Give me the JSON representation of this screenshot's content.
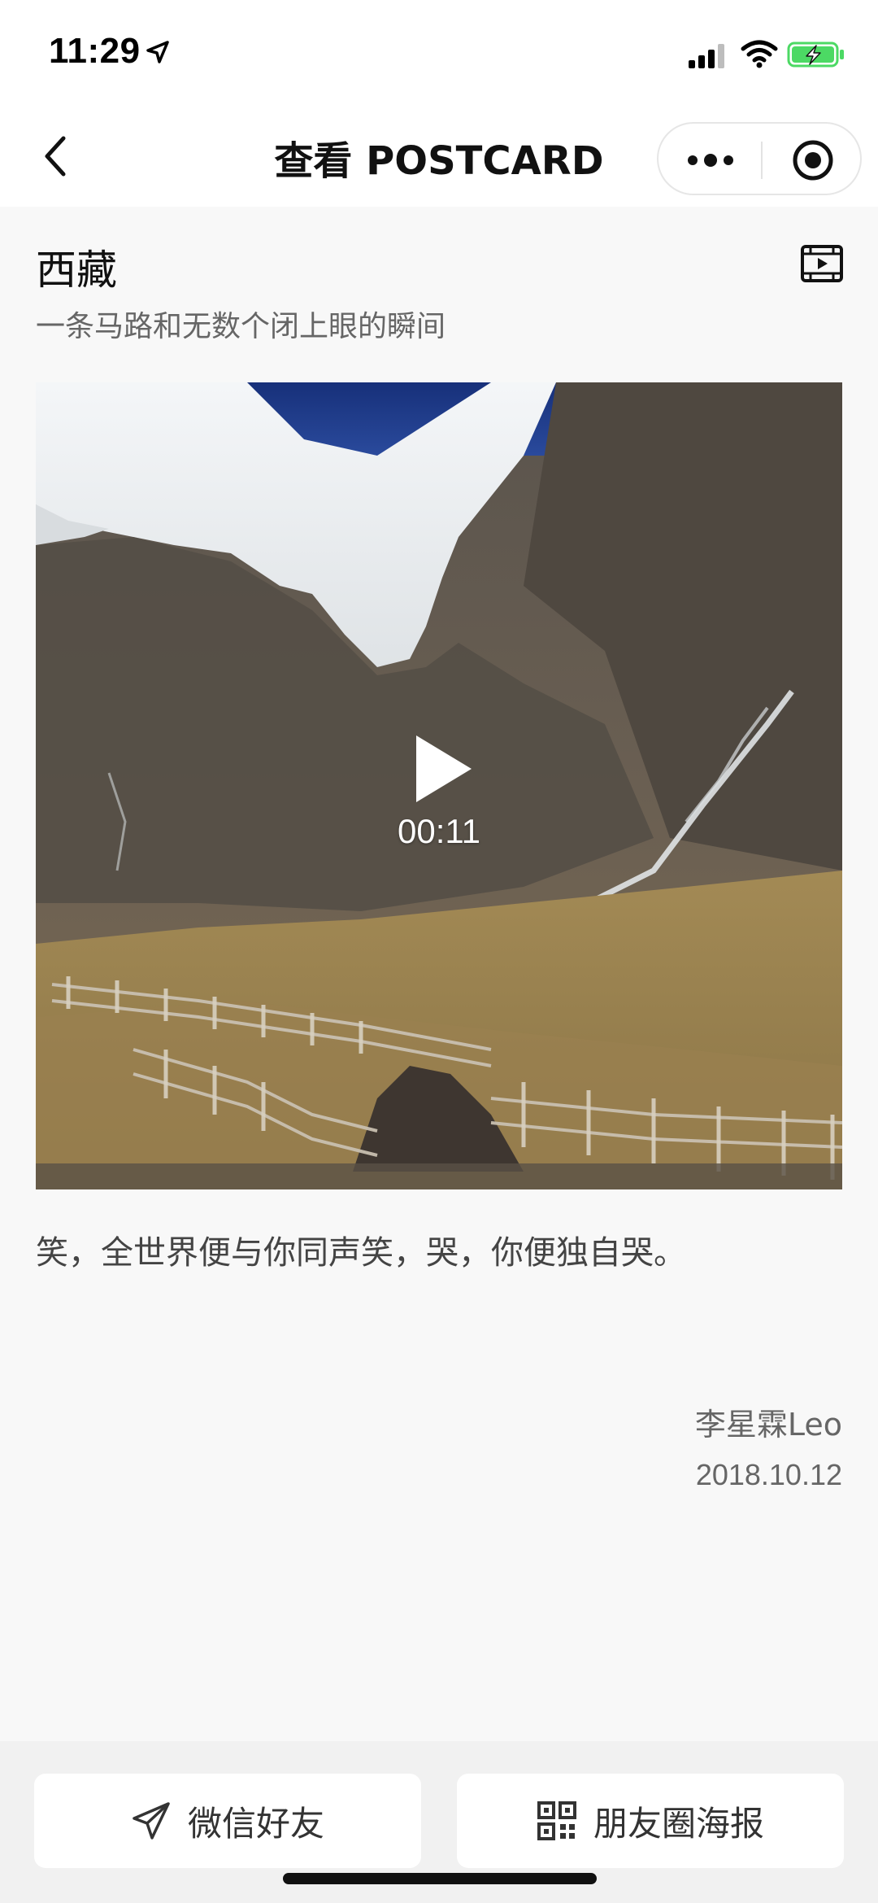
{
  "status_bar": {
    "time": "11:29"
  },
  "nav": {
    "title": "查看 POSTCARD"
  },
  "post": {
    "title": "西藏",
    "subtitle": "一条马路和无数个闭上眼的瞬间",
    "video_duration": "00:11",
    "body": "笑，全世界便与你同声笑，哭，你便独自哭。",
    "author": "李星霖Leo",
    "date": "2018.10.12"
  },
  "actions": {
    "share_friend": "微信好友",
    "moments_poster": "朋友圈海报"
  },
  "colors": {
    "accent_battery": "#4cd964",
    "text_primary": "#111111",
    "text_secondary": "#666666",
    "background": "#f8f8f8"
  }
}
